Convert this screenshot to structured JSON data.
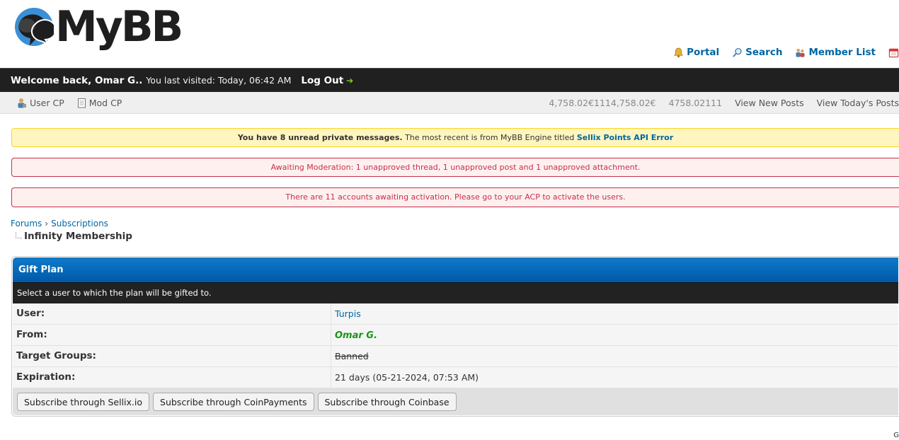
{
  "header": {
    "logo_text": "MyBB",
    "toplinks": [
      {
        "label": "Portal",
        "icon": "bell-icon"
      },
      {
        "label": "Search",
        "icon": "search-icon"
      },
      {
        "label": "Member List",
        "icon": "members-icon"
      },
      {
        "label": "",
        "icon": "calendar-icon"
      }
    ]
  },
  "welcome": {
    "greeting": "Welcome back, Omar G..",
    "last_visit": "You last visited: Today, 06:42 AM",
    "logout_label": "Log Out"
  },
  "panel": {
    "user_cp": "User CP",
    "mod_cp": "Mod CP",
    "points": "4,758.02€1114,758.02€",
    "points2": "4758.02111",
    "view_new": "View New Posts",
    "view_today": "View Today's Posts"
  },
  "notices": {
    "pm_bold": "You have 8 unread private messages.",
    "pm_text": " The most recent is from MyBB Engine titled ",
    "pm_link": "Sellix Points API Error",
    "moderation": "Awaiting Moderation: 1 unapproved thread, 1 unapproved post and 1 unapproved attachment.",
    "activation": "There are 11 accounts awaiting activation. Please go to your ACP to activate the users."
  },
  "breadcrumb": {
    "forums": "Forums",
    "subscriptions": "Subscriptions",
    "current": "Infinity Membership"
  },
  "gift": {
    "title": "Gift Plan",
    "subtitle": "Select a user to which the plan will be gifted to.",
    "rows": {
      "user_label": "User:",
      "user_value": "Turpis",
      "from_label": "From:",
      "from_value": "Omar G.",
      "groups_label": "Target Groups:",
      "groups_value": "Banned",
      "expiration_label": "Expiration:",
      "expiration_value": "21 days (05-21-2024, 07:53 AM)"
    },
    "buttons": {
      "sellix": "Subscribe through Sellix.io",
      "coinpayments": "Subscribe through CoinPayments",
      "coinbase": "Subscribe through Coinbase"
    }
  },
  "corner": "G",
  "colors": {
    "link": "#0066a2",
    "thead": "#0f7ac9",
    "dark": "#202020",
    "from_green": "#199519",
    "error_red": "#c4314b"
  }
}
